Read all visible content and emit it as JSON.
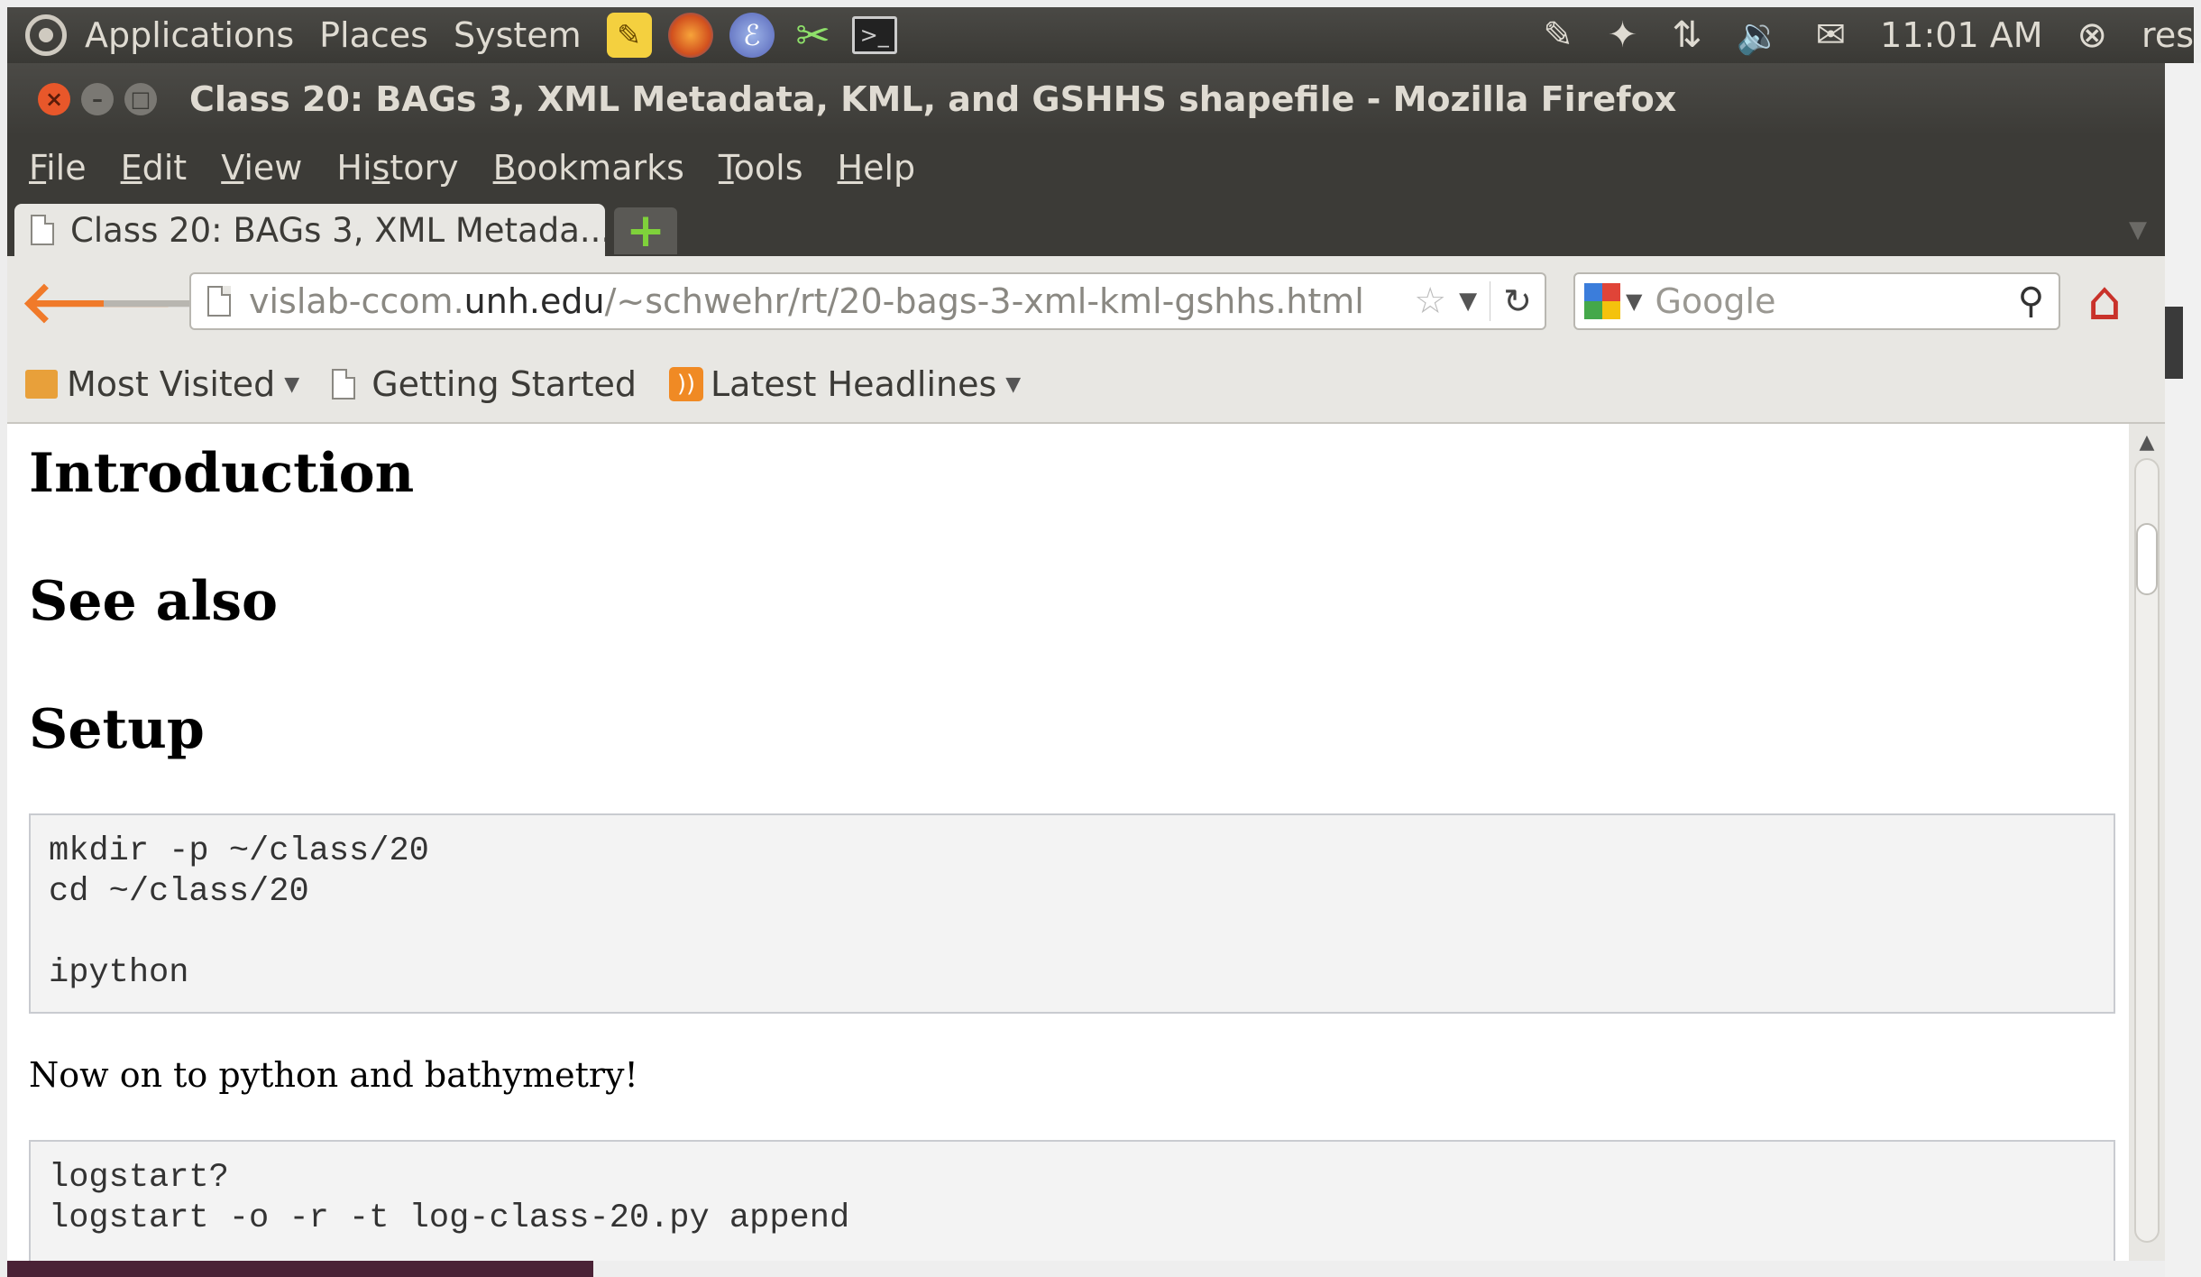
{
  "panel": {
    "menus": [
      "Applications",
      "Places",
      "System"
    ],
    "clock": "11:01 AM",
    "user": "res"
  },
  "window": {
    "title": "Class 20: BAGs 3, XML Metadata, KML, and GSHHS shapefile - Mozilla Firefox"
  },
  "menubar": {
    "items": [
      {
        "u": "F",
        "rest": "ile"
      },
      {
        "u": "E",
        "rest": "dit"
      },
      {
        "u": "V",
        "rest": "iew"
      },
      {
        "pre": "Hi",
        "u": "s",
        "rest": "tory"
      },
      {
        "u": "B",
        "rest": "ookmarks"
      },
      {
        "u": "T",
        "rest": "ools"
      },
      {
        "u": "H",
        "rest": "elp"
      }
    ]
  },
  "tab": {
    "label": "Class 20: BAGs 3, XML Metada..."
  },
  "url": {
    "prefix": "vislab-ccom.",
    "domain": "unh.edu",
    "path": "/~schwehr/rt/20-bags-3-xml-kml-gshhs.html"
  },
  "search": {
    "placeholder": "Google"
  },
  "bookmarks": {
    "most_visited": "Most Visited",
    "getting_started": "Getting Started",
    "latest_headlines": "Latest Headlines"
  },
  "content": {
    "h_intro": "Introduction",
    "h_see_also": "See also",
    "h_setup": "Setup",
    "code1": "mkdir -p ~/class/20\ncd ~/class/20\n\nipython",
    "para1": "Now on to python and bathymetry!",
    "code2": "logstart?\nlogstart -o -r -t log-class-20.py append"
  },
  "colors": {
    "panel_bg": "#3c3b37",
    "close_button": "#e8572a",
    "back_arrow": "#f07a2a",
    "code_bg": "#f3f3f3"
  }
}
